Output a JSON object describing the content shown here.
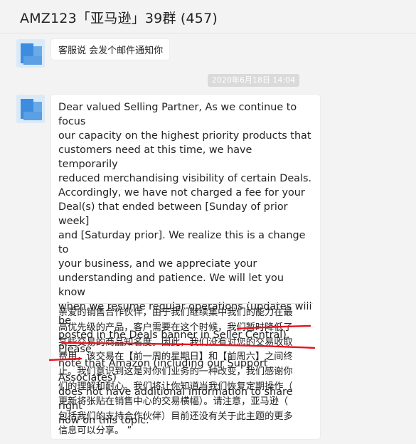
{
  "header": {
    "title": "AMZ123「亚马逊」39群 (457)"
  },
  "messages": [
    {
      "text": "客服说  会发个邮件通知你"
    },
    {
      "text_en": "Dear valued Selling Partner, As we continue to focus\nour capacity on the highest priority products that\ncustomers need at this time, we have temporarily\nreduced merchandising visibility of certain Deals.\nAccordingly, we have not charged a fee for your\nDeal(s) that ended between [Sunday of prior week]\nand [Saturday prior]. We realize this is a change to\nyour business, and we appreciate your\nunderstanding and patience. We will let you know\nwhen we resume regular operations (updates will be\nposted in the Deals banner in Seller Central). Please\nnote that Amazon (including our Support Associates)\n does not have additional information to share right\nnow on this topic.  “",
      "text_zh": "亲爱的销售合作伙伴，由于我们继续集中我们的能力在最\n高优先级的产品，客户需要在这个时候，我们暂时降低了\n某些交易的商品知名度。因此，我们没有对您的交易收取\n费用，该交易在【前一周的星期日】和【前周六】之间终\n止。我们意识到这是对你们业务的一种改变，我们感谢你\n们的理解和耐心。我们将让你知道当我们恢复定期操作（\n更新将张贴在销售中心的交易横幅）。请注意，亚马逊（\n包括我们的支持合作伙伴）目前还没有关于此主题的更多\n信息可以分享。 ”"
    }
  ],
  "timestamp": "2020年6月18日 14:04",
  "colors": {
    "background": "#f3f3f3",
    "bubble": "#ffffff",
    "annotation": "#e8141f",
    "timestamp_pill": "#dadada"
  },
  "icons": {
    "avatar": "avatar-icon"
  }
}
